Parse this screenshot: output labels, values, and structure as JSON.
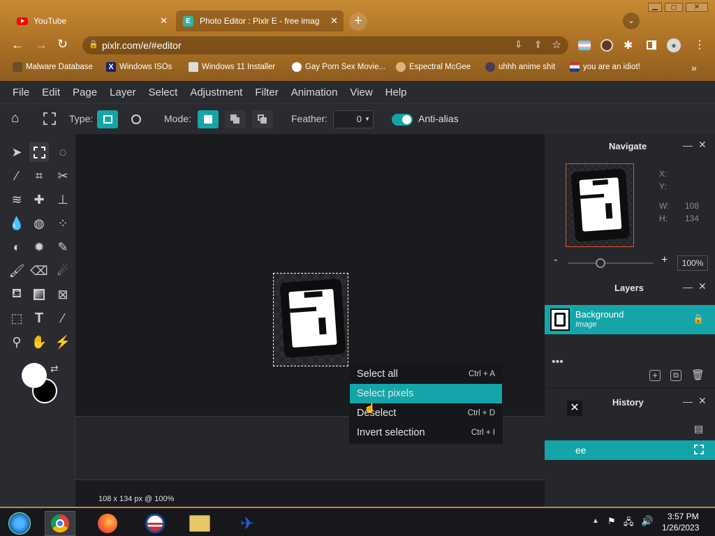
{
  "browser": {
    "tabs": [
      {
        "title": "YouTube",
        "icon": "youtube-icon"
      },
      {
        "title": "Photo Editor : Pixlr E - free image",
        "icon": "pixlr-icon"
      }
    ],
    "url": "pixlr.com/e/#editor",
    "bookmarks": [
      "Malware Database",
      "Windows ISOs",
      "Windows 11 Installer",
      "Gay Porn Sex Movie...",
      "Espectral McGee",
      "uhhh anime shit",
      "you are an idiot!"
    ],
    "more_bookmarks": "»"
  },
  "menu": [
    "File",
    "Edit",
    "Page",
    "Layer",
    "Select",
    "Adjustment",
    "Filter",
    "Animation",
    "View",
    "Help"
  ],
  "toolbar": {
    "type_label": "Type:",
    "mode_label": "Mode:",
    "feather_label": "Feather:",
    "feather_value": "0",
    "antialias_label": "Anti-alias"
  },
  "navigate": {
    "title": "Navigate",
    "x_label": "X:",
    "y_label": "Y:",
    "w_label": "W:",
    "w_value": "108",
    "h_label": "H:",
    "h_value": "134",
    "zoom": "100%",
    "minus": "-",
    "plus": "+"
  },
  "layers": {
    "title": "Layers",
    "items": [
      {
        "name": "Background",
        "type": "Image"
      }
    ]
  },
  "history": {
    "title": "History",
    "item_partial": "ee"
  },
  "context_menu": [
    {
      "label": "Select all",
      "shortcut": "Ctrl + A"
    },
    {
      "label": "Select pixels",
      "shortcut": ""
    },
    {
      "label": "Deselect",
      "shortcut": "Ctrl + D"
    },
    {
      "label": "Invert selection",
      "shortcut": "Ctrl + I"
    }
  ],
  "status": "108 x 134 px @ 100%",
  "clock": {
    "time": "3:57 PM",
    "date": "1/26/2023"
  },
  "colors": {
    "accent": "#14a5a8",
    "panel": "#2a2b30",
    "canvas_bg": "#1a1b1f"
  }
}
